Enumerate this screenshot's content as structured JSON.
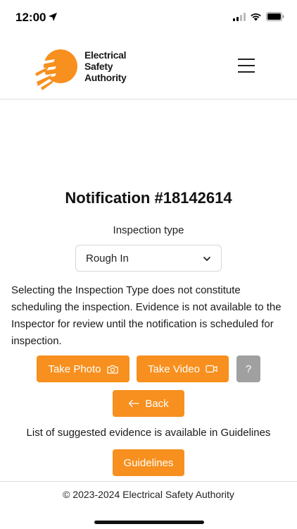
{
  "status_bar": {
    "time": "12:00"
  },
  "header": {
    "logo_lines": [
      "Electrical",
      "Safety",
      "Authority"
    ],
    "brand_color": "#f7901e"
  },
  "main": {
    "title": "Notification #18142614",
    "inspection_label": "Inspection type",
    "inspection_selected": "Rough In",
    "disclaimer": "Selecting the Inspection Type does not constitute scheduling the inspection. Evidence is not available to the Inspector for review until the notification is scheduled for inspection.",
    "buttons": {
      "take_photo": "Take Photo",
      "take_video": "Take Video",
      "help": "?",
      "back": "Back",
      "guidelines": "Guidelines"
    },
    "suggested_text": "List of suggested evidence is available in Guidelines"
  },
  "footer": {
    "copyright": "© 2023-2024 Electrical Safety Authority"
  },
  "icons": {
    "camera": "camera-icon",
    "video": "video-camera-icon",
    "back_arrow": "arrow-left-icon",
    "menu": "hamburger-menu-icon",
    "chevron": "chevron-down-icon"
  }
}
